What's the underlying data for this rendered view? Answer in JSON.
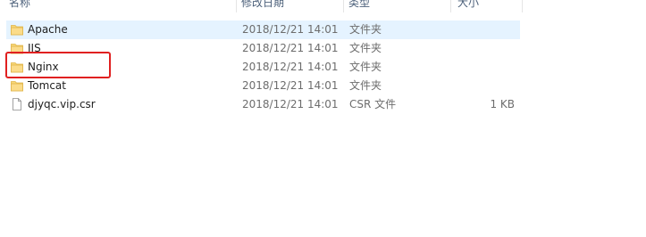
{
  "columns": {
    "name": "名称",
    "date": "修改日期",
    "type": "类型",
    "size": "大小"
  },
  "files": [
    {
      "name": "Apache",
      "date": "2018/12/21 14:01",
      "type": "文件夹",
      "size": "",
      "icon": "folder-icon",
      "selected": true
    },
    {
      "name": "IIS",
      "date": "2018/12/21 14:01",
      "type": "文件夹",
      "size": "",
      "icon": "folder-icon",
      "selected": false
    },
    {
      "name": "Nginx",
      "date": "2018/12/21 14:01",
      "type": "文件夹",
      "size": "",
      "icon": "folder-icon",
      "selected": false
    },
    {
      "name": "Tomcat",
      "date": "2018/12/21 14:01",
      "type": "文件夹",
      "size": "",
      "icon": "folder-icon",
      "selected": false
    },
    {
      "name": "djyqc.vip.csr",
      "date": "2018/12/21 14:01",
      "type": "CSR 文件",
      "size": "1 KB",
      "icon": "document-icon",
      "selected": false
    }
  ],
  "colors": {
    "selection": "#e5f3ff",
    "folder": "#f8d775",
    "highlight_box": "#e02020"
  }
}
